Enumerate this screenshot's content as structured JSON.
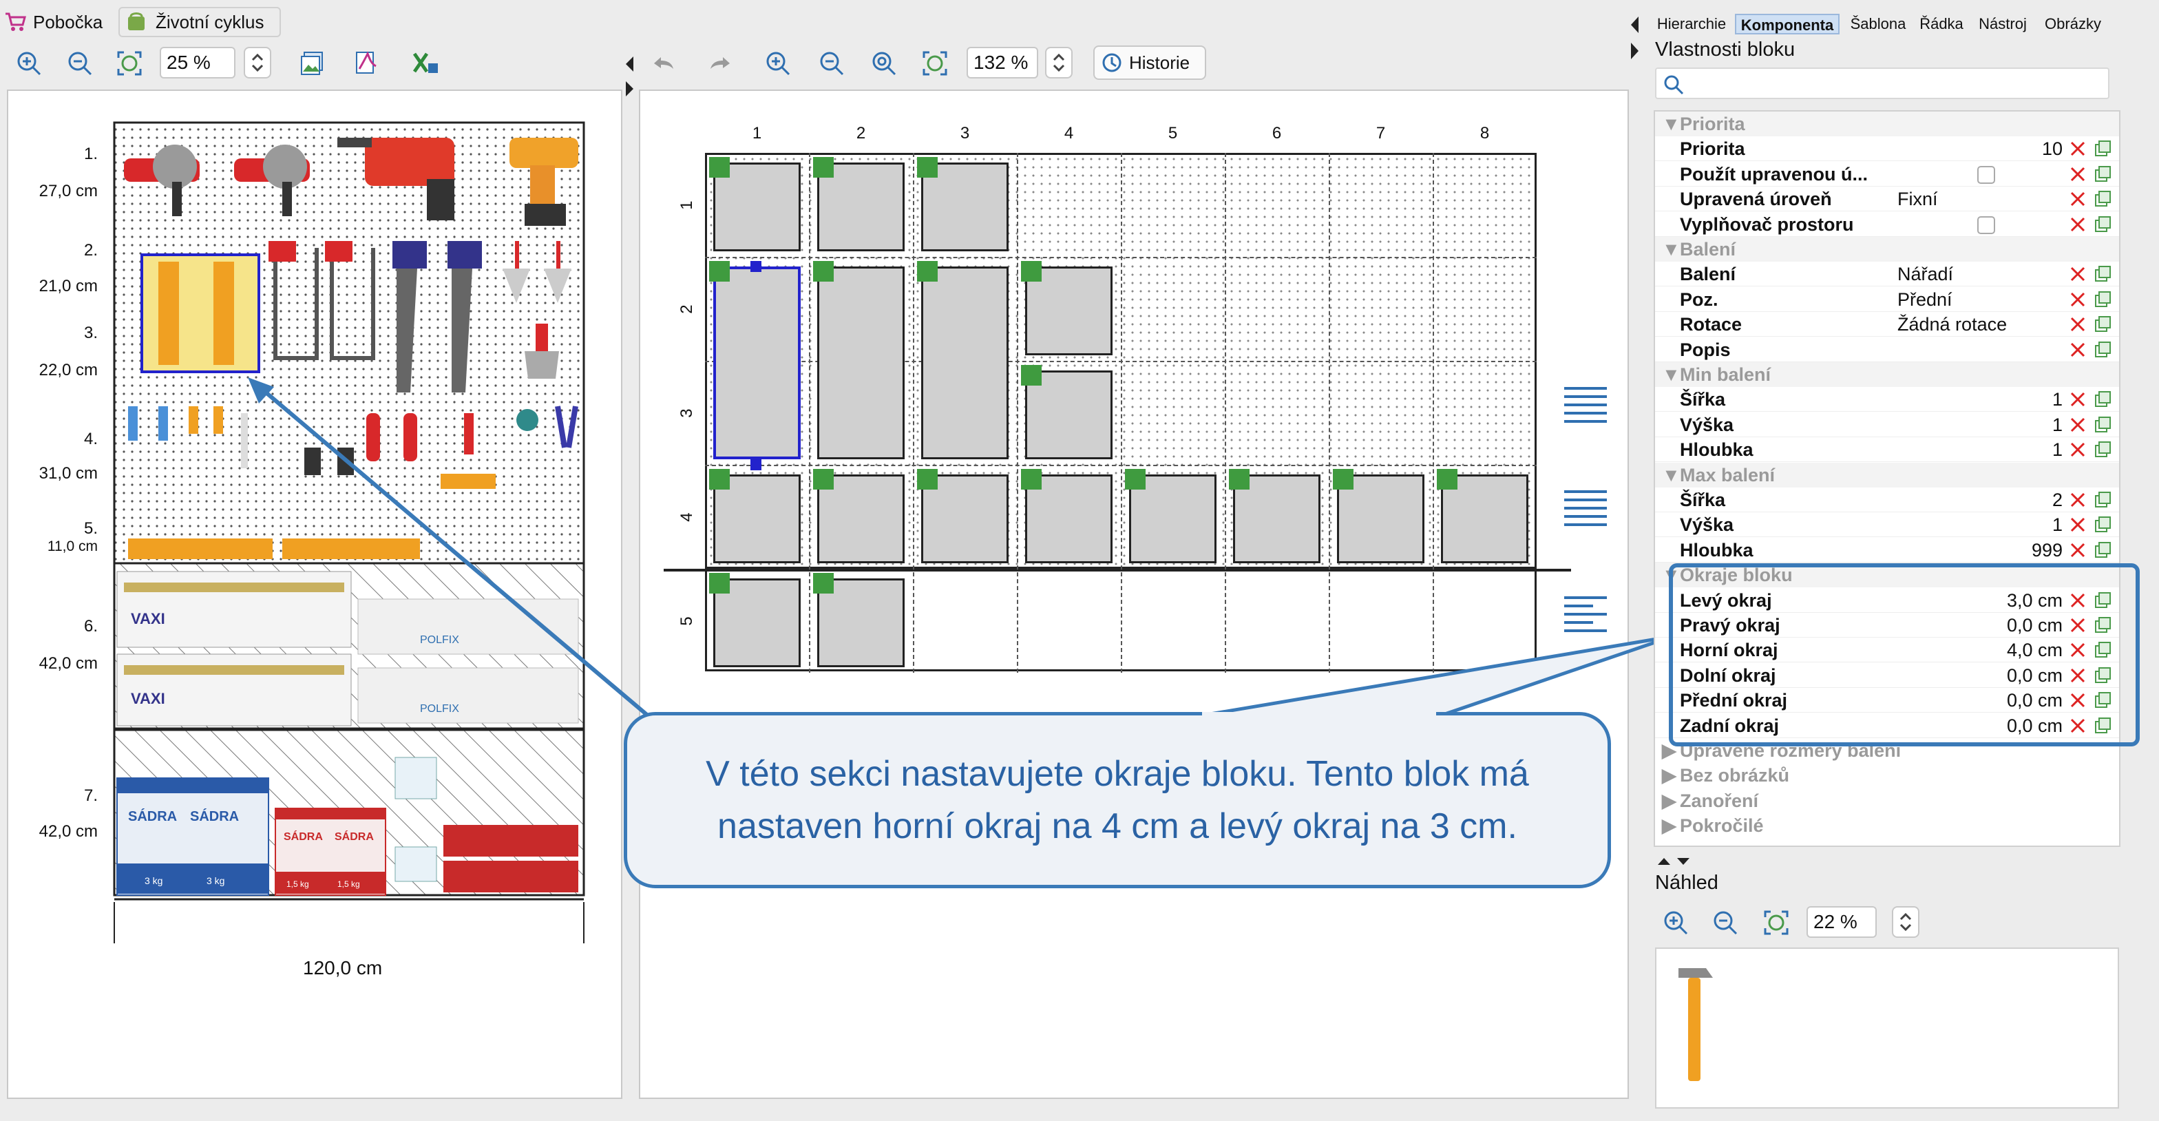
{
  "toolbar": {
    "branch_label": "Pobočka",
    "lifecycle_label": "Životní cyklus",
    "left_zoom": "25 %",
    "center_zoom": "132 %",
    "history_label": "Historie"
  },
  "right_tabs": [
    {
      "label": "Hierarchie"
    },
    {
      "label": "Komponenta",
      "active": true
    },
    {
      "label": "Šablona"
    },
    {
      "label": "Řádka"
    },
    {
      "label": "Nástroj"
    },
    {
      "label": "Obrázky"
    }
  ],
  "properties": {
    "title": "Vlastnosti bloku",
    "search_placeholder": "",
    "sections": {
      "priorita": "Priorita",
      "baleni": "Balení",
      "min_baleni": "Min balení",
      "max_baleni": "Max balení",
      "okraje": "Okraje bloku",
      "upravene": "Upravené rozměry balení",
      "bez_obrazku": "Bez obrázků",
      "zanoreni": "Zanoření",
      "pokrocile": "Pokročilé"
    },
    "rows": {
      "priorita": {
        "label": "Priorita",
        "value": "10"
      },
      "pouzit": {
        "label": "Použít upravenou ú..."
      },
      "upravena": {
        "label": "Upravená úroveň",
        "value": "Fixní"
      },
      "vyplnovac": {
        "label": "Vyplňovač prostoru"
      },
      "baleni": {
        "label": "Balení",
        "value": "Nářadí"
      },
      "poz": {
        "label": "Poz.",
        "value": "Přední"
      },
      "rotace": {
        "label": "Rotace",
        "value": "Žádná rotace"
      },
      "popis": {
        "label": "Popis",
        "value": ""
      },
      "min_sirka": {
        "label": "Šířka",
        "value": "1"
      },
      "min_vyska": {
        "label": "Výška",
        "value": "1"
      },
      "min_hloubka": {
        "label": "Hloubka",
        "value": "1"
      },
      "max_sirka": {
        "label": "Šířka",
        "value": "2"
      },
      "max_vyska": {
        "label": "Výška",
        "value": "1"
      },
      "max_hloubka": {
        "label": "Hloubka",
        "value": "999"
      },
      "levy": {
        "label": "Levý okraj",
        "value": "3,0 cm"
      },
      "pravy": {
        "label": "Pravý okraj",
        "value": "0,0 cm"
      },
      "horni": {
        "label": "Horní okraj",
        "value": "4,0 cm"
      },
      "dolni": {
        "label": "Dolní okraj",
        "value": "0,0 cm"
      },
      "predni": {
        "label": "Přední okraj",
        "value": "0,0 cm"
      },
      "zadni": {
        "label": "Zadní okraj",
        "value": "0,0 cm"
      }
    }
  },
  "preview": {
    "title": "Náhled",
    "zoom": "22 %"
  },
  "planogram": {
    "width_label": "120,0 cm",
    "shelves": [
      {
        "num": "1.",
        "height": "27,0 cm"
      },
      {
        "num": "2.",
        "height": "21,0 cm"
      },
      {
        "num": "3.",
        "height": "22,0 cm"
      },
      {
        "num": "4.",
        "height": "31,0 cm"
      },
      {
        "num": "5.",
        "height": "11,0 cm"
      },
      {
        "num": "6.",
        "height": "42,0 cm"
      },
      {
        "num": "7.",
        "height": "42,0 cm"
      }
    ],
    "product_text": {
      "sadra": "SÁDRA",
      "weight_3kg": "3 kg",
      "weight_15kg": "1,5 kg",
      "brand_vaxi": "VAXI",
      "brand_polfix": "POLFIX"
    }
  },
  "grid": {
    "columns": [
      "1",
      "2",
      "3",
      "4",
      "5",
      "6",
      "7",
      "8"
    ],
    "rows": [
      "1",
      "2",
      "3",
      "4",
      "5"
    ]
  },
  "callout": {
    "text": "V této sekci nastavujete okraje bloku. Tento blok má nastaven horní okraj na 4 cm a levý okraj na 3 cm."
  },
  "colors": {
    "accent": "#3a7ab8",
    "callout_bg": "#eef2f7",
    "cell_marker": "#3f9b3f",
    "selection": "#2222cc"
  }
}
